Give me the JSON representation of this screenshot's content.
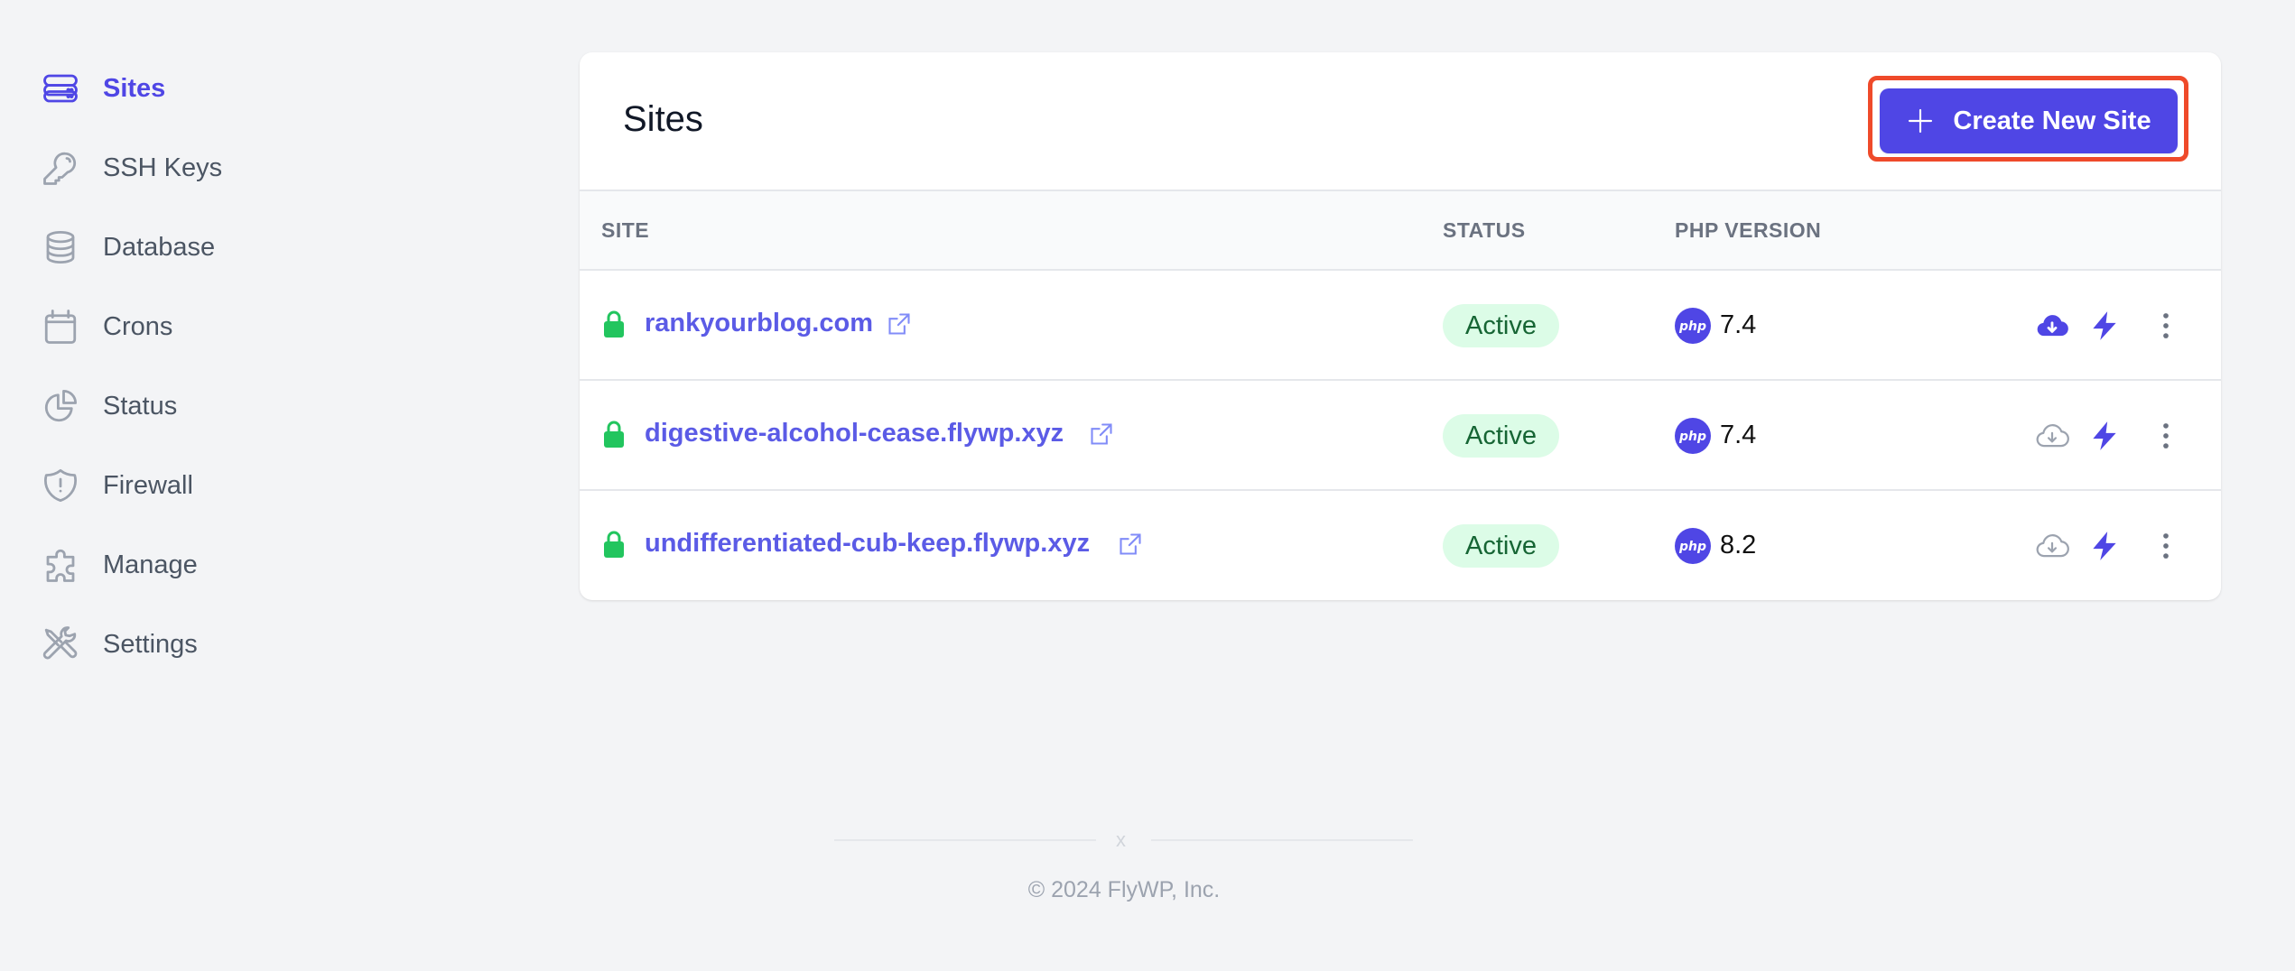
{
  "sidebar": {
    "items": [
      {
        "label": "Sites",
        "icon": "server-stack-icon",
        "active": true
      },
      {
        "label": "SSH Keys",
        "icon": "key-icon",
        "active": false
      },
      {
        "label": "Database",
        "icon": "database-icon",
        "active": false
      },
      {
        "label": "Crons",
        "icon": "calendar-icon",
        "active": false
      },
      {
        "label": "Status",
        "icon": "pie-chart-icon",
        "active": false
      },
      {
        "label": "Firewall",
        "icon": "shield-exclamation-icon",
        "active": false
      },
      {
        "label": "Manage",
        "icon": "puzzle-icon",
        "active": false
      },
      {
        "label": "Settings",
        "icon": "wrench-screwdriver-icon",
        "active": false
      }
    ]
  },
  "main": {
    "title": "Sites",
    "create_button": "Create New Site",
    "columns": [
      "SITE",
      "STATUS",
      "PHP VERSION"
    ],
    "rows": [
      {
        "site": "rankyourblog.com",
        "status": "Active",
        "php": "7.4",
        "backup_highlighted": true
      },
      {
        "site": "digestive-alcohol-cease.flywp.xyz",
        "status": "Active",
        "php": "7.4",
        "backup_highlighted": false
      },
      {
        "site": "undifferentiated-cub-keep.flywp.xyz",
        "status": "Active",
        "php": "8.2",
        "backup_highlighted": false
      }
    ]
  },
  "footer": {
    "separator": "x",
    "copyright": "© 2024 FlyWP, Inc."
  },
  "colors": {
    "accent": "#4f46e5",
    "link": "#5b5be6",
    "success": "#22c55e",
    "badge_bg": "#dcfce7",
    "badge_text": "#166534",
    "highlight_outline": "#ef4a2a"
  }
}
